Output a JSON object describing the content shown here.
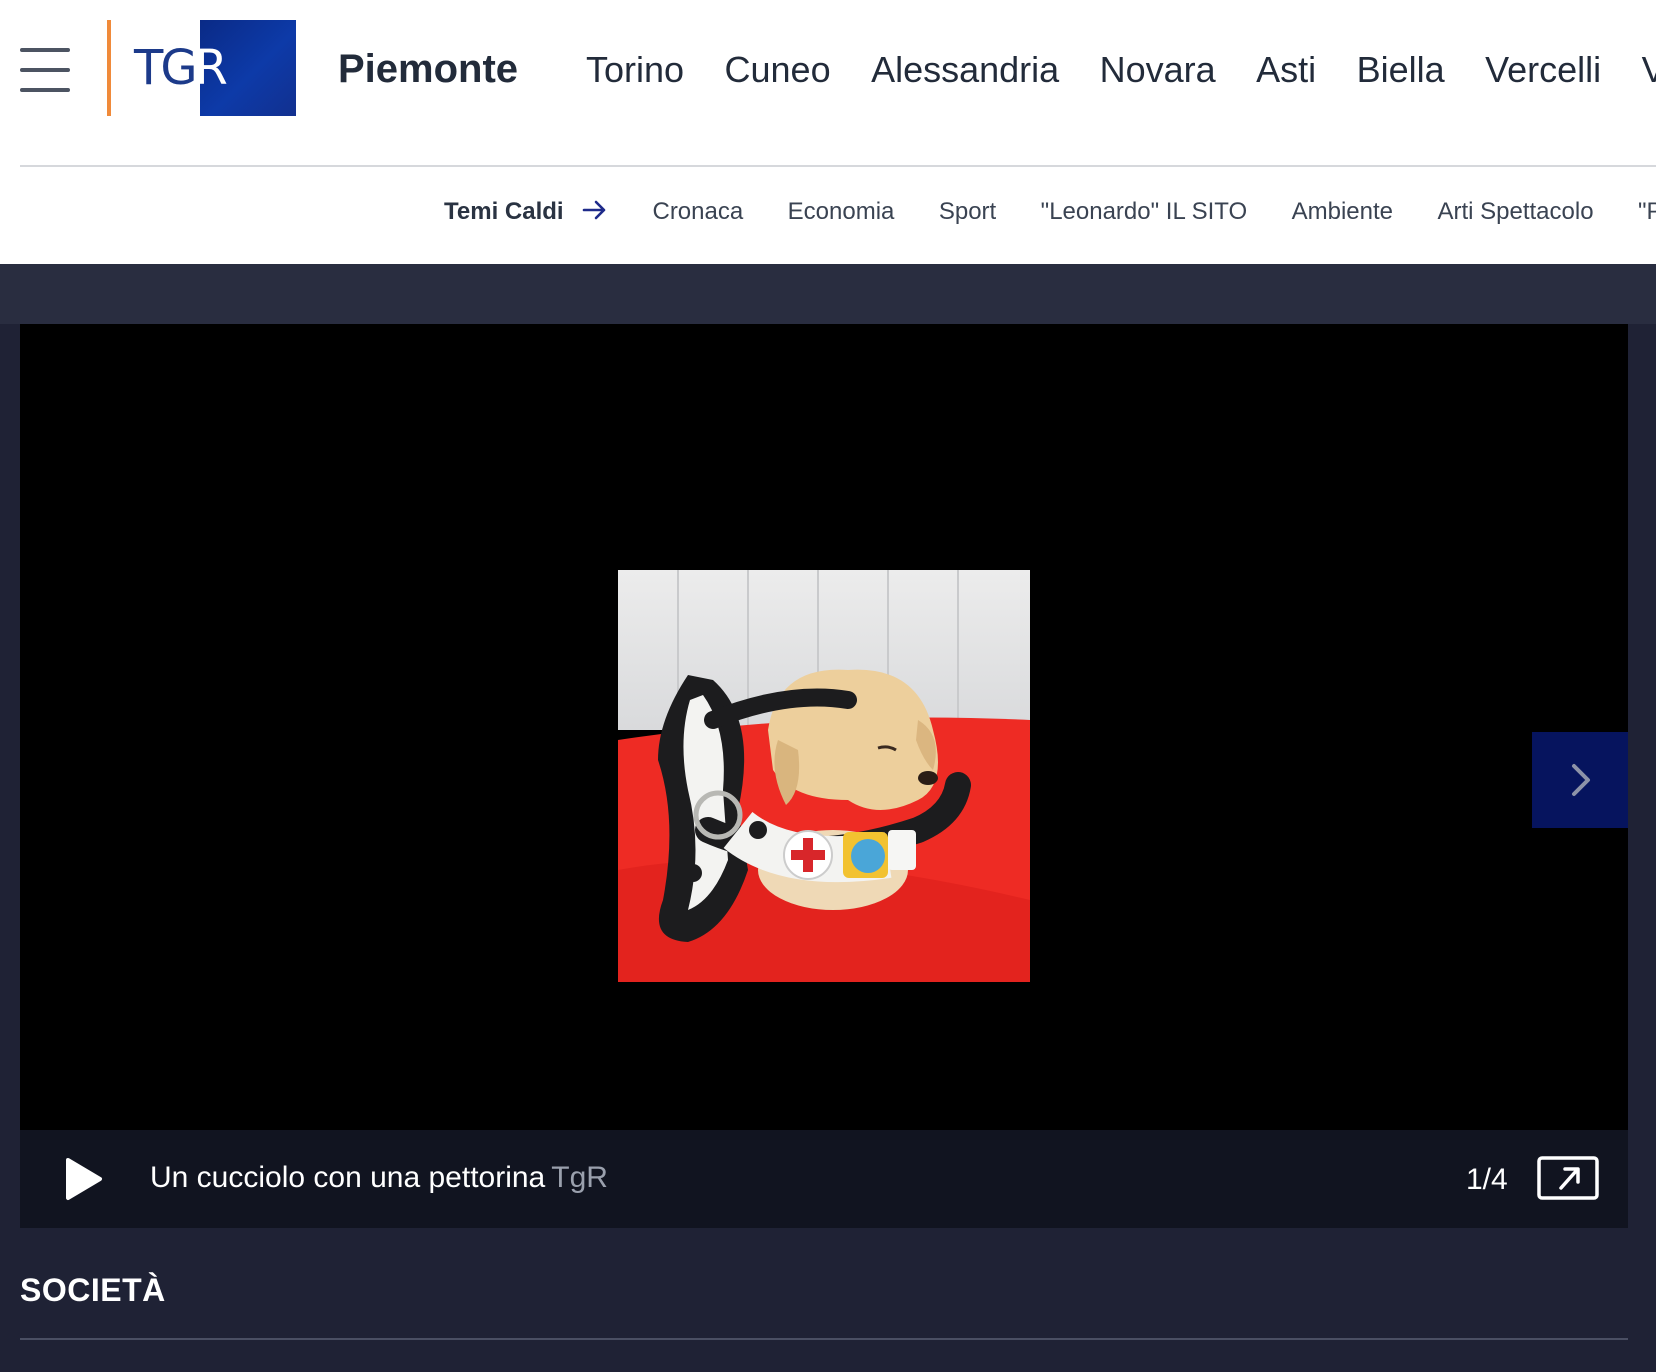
{
  "header": {
    "logo_text": "TGR",
    "region": "Piemonte",
    "cities": [
      "Torino",
      "Cuneo",
      "Alessandria",
      "Novara",
      "Asti",
      "Biella",
      "Vercelli",
      "VCO"
    ]
  },
  "subnav": {
    "hot_label": "Temi Caldi",
    "items": [
      "Cronaca",
      "Economia",
      "Sport",
      "\"Leonardo\" IL SITO",
      "Ambiente",
      "Arti Spettacolo",
      "\"Pet"
    ]
  },
  "gallery": {
    "caption": "Un cucciolo con una pettorina",
    "source": "TgR",
    "counter": "1/4"
  },
  "section": {
    "title": "SOCIETÀ"
  },
  "colors": {
    "accent_orange": "#f08a3a",
    "brand_blue": "#0d3aa8",
    "next_button": "#06145e",
    "page_dark": "#1f2235"
  },
  "icons": [
    "menu-icon",
    "arrow-right-icon",
    "chevron-right-icon",
    "play-icon",
    "expand-icon"
  ]
}
